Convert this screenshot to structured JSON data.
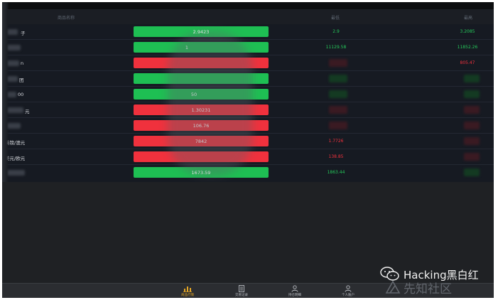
{
  "header": {
    "col_name": "商品名称",
    "col_price_buy": "最低",
    "col_price_sell": "最高"
  },
  "rows": [
    {
      "name": "子",
      "bar_value": "2.9423",
      "bar_color": "green",
      "c3": "2.9",
      "c3_color": "green",
      "c4": "3.2085",
      "c4_color": "green"
    },
    {
      "name": "",
      "bar_value": "1",
      "bar_color": "green",
      "c3": "11129.58",
      "c3_color": "green",
      "c4": "11852.26",
      "c4_color": "green"
    },
    {
      "name": "n",
      "bar_value": "",
      "bar_color": "red",
      "c3": "",
      "c3_color": "red",
      "c4": "805.47",
      "c4_color": "red"
    },
    {
      "name": "团",
      "bar_value": "",
      "bar_color": "green",
      "c3": "",
      "c3_color": "green",
      "c4": "",
      "c4_color": "green"
    },
    {
      "name": "00",
      "bar_value": "50",
      "bar_color": "green",
      "c3": "",
      "c3_color": "green",
      "c4": "",
      "c4_color": "green"
    },
    {
      "name": "元",
      "bar_value": "1.30231",
      "bar_color": "red",
      "c3": "",
      "c3_color": "red",
      "c4": "",
      "c4_color": "red"
    },
    {
      "name": "",
      "bar_value": "106.76",
      "bar_color": "red",
      "c3": "",
      "c3_color": "red",
      "c4": "",
      "c4_color": "red"
    },
    {
      "name": "英镑/澳元",
      "bar_value": "7842",
      "bar_color": "red",
      "c3": "1.7726",
      "c3_color": "red",
      "c4": "",
      "c4_color": "red"
    },
    {
      "name": "美元/欧元",
      "bar_value": "",
      "bar_color": "red",
      "c3": "138.85",
      "c3_color": "red",
      "c4": "",
      "c4_color": "red"
    },
    {
      "name": "",
      "bar_value": "1673.59",
      "bar_color": "green",
      "c3": "1863.44",
      "c3_color": "green",
      "c4": "",
      "c4_color": "green"
    }
  ],
  "bottom_nav": [
    {
      "label": "商品行情",
      "icon": "chart-icon",
      "active": true
    },
    {
      "label": "交易记录",
      "icon": "records-icon",
      "active": false
    },
    {
      "label": "持仓明细",
      "icon": "person-icon",
      "active": false
    },
    {
      "label": "个人账户",
      "icon": "account-icon",
      "active": false
    }
  ],
  "watermarks": {
    "channel": "Hacking黑白红",
    "site": "先知社区"
  },
  "colors": {
    "up": "#1ebf53",
    "down": "#f0313d",
    "accent": "#e5a624",
    "background": "#161a22"
  }
}
